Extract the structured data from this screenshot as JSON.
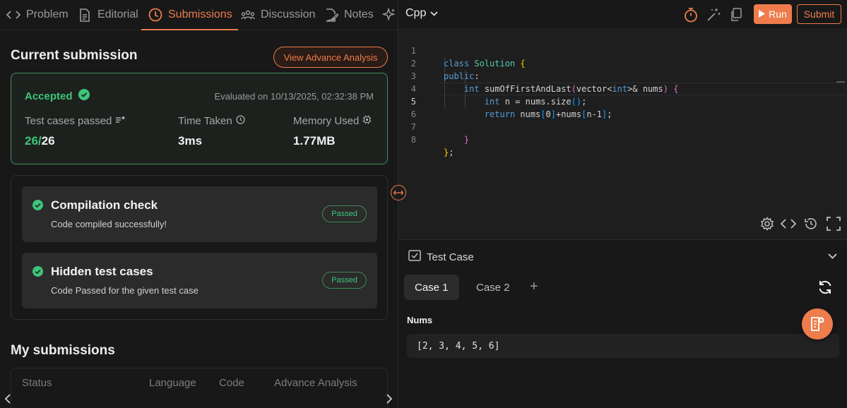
{
  "colors": {
    "accent": "#ee7c4c",
    "success": "#3cc67a",
    "bg": "#181818"
  },
  "tabs": [
    {
      "label": "Problem",
      "icon": "code-brackets-icon"
    },
    {
      "label": "Editorial",
      "icon": "document-icon"
    },
    {
      "label": "Submissions",
      "icon": "clock-icon",
      "active": true
    },
    {
      "label": "Discussion",
      "icon": "people-icon"
    },
    {
      "label": "Notes",
      "icon": "note-edit-icon"
    }
  ],
  "current": {
    "title": "Current submission",
    "advance_btn": "View Advance Analysis",
    "status": "Accepted",
    "evaluated": "Evaluated on 10/13/2025, 02:32:38 PM",
    "tests_label": "Test cases passed",
    "tests_passed": "26/",
    "tests_total": "26",
    "time_label": "Time Taken",
    "time_value": "3ms",
    "memory_label": "Memory Used",
    "memory_value": "1.77MB"
  },
  "checks": [
    {
      "title": "Compilation check",
      "subtitle": "Code compiled successfully!",
      "badge": "Passed"
    },
    {
      "title": "Hidden test cases",
      "subtitle": "Code Passed for the given test case",
      "badge": "Passed"
    }
  ],
  "my_submissions": {
    "title": "My submissions",
    "columns": [
      "Status",
      "Language",
      "Code",
      "Advance Analysis"
    ]
  },
  "editor": {
    "language": "Cpp",
    "run_label": "Run",
    "submit_label": "Submit",
    "line_numbers": [
      "1",
      "2",
      "3",
      "4",
      "5",
      "6",
      "7",
      "8"
    ],
    "code_lines": [
      "class Solution {",
      "public:",
      "    int sumOfFirstAndLast(vector<int>& nums) {",
      "        int n = nums.size();",
      "        return nums[0]+nums[n-1];",
      "",
      "    }",
      "};"
    ]
  },
  "testcase": {
    "header": "Test Case",
    "cases": [
      "Case 1",
      "Case 2"
    ],
    "add_label": "+",
    "var_name": "Nums",
    "var_value": "[2, 3, 4, 5, 6]"
  }
}
